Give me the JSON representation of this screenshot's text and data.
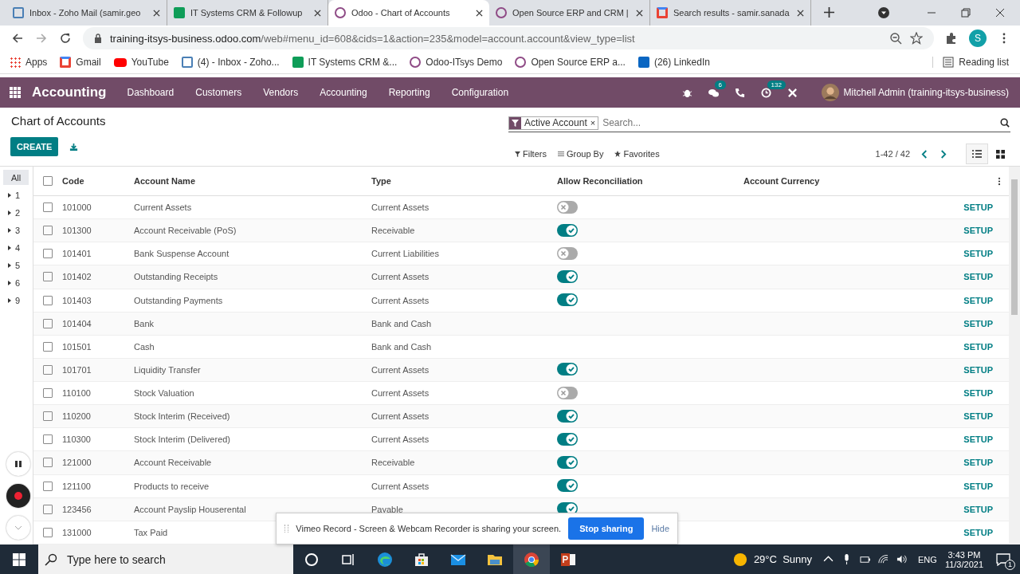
{
  "browser": {
    "tabs": [
      {
        "title": "Inbox - Zoho Mail (samir.geo",
        "kind": "mail",
        "selected": false
      },
      {
        "title": "IT Systems CRM & Followup",
        "kind": "sheet",
        "selected": false
      },
      {
        "title": "Odoo - Chart of Accounts",
        "kind": "odoo",
        "selected": true
      },
      {
        "title": "Open Source ERP and CRM |",
        "kind": "odoo",
        "selected": false
      },
      {
        "title": "Search results - samir.sanada",
        "kind": "gmail",
        "selected": false
      }
    ],
    "url_host": "training-itsys-business.odoo.com",
    "url_path": "/web#menu_id=608&cids=1&action=235&model=account.account&view_type=list",
    "profile_initial": "S",
    "bookmarks": [
      {
        "label": "Apps",
        "kind": "apps"
      },
      {
        "label": "Gmail",
        "kind": "gmail"
      },
      {
        "label": "YouTube",
        "kind": "youtube"
      },
      {
        "label": "(4) - Inbox - Zoho...",
        "kind": "mail"
      },
      {
        "label": "IT Systems CRM &...",
        "kind": "sheet"
      },
      {
        "label": "Odoo-ITsys Demo",
        "kind": "odoo"
      },
      {
        "label": "Open Source ERP a...",
        "kind": "odoo"
      },
      {
        "label": "(26) LinkedIn",
        "kind": "linkedin"
      }
    ],
    "reading_list": "Reading list"
  },
  "navbar": {
    "app": "Accounting",
    "menu": [
      "Dashboard",
      "Customers",
      "Vendors",
      "Accounting",
      "Reporting",
      "Configuration"
    ],
    "messages_count": "6",
    "activities_count": "132",
    "user": "Mitchell Admin (training-itsys-business)"
  },
  "control_panel": {
    "title": "Chart of Accounts",
    "create": "CREATE",
    "facet": "Active Account",
    "facet_remove": "×",
    "search_placeholder": "Search...",
    "filters": "Filters",
    "group_by": "Group By",
    "favorites": "Favorites",
    "pager": "1-42 / 42"
  },
  "groups": [
    {
      "label": "All",
      "selected": true
    },
    {
      "label": "1",
      "selected": false
    },
    {
      "label": "2",
      "selected": false
    },
    {
      "label": "3",
      "selected": false
    },
    {
      "label": "4",
      "selected": false
    },
    {
      "label": "5",
      "selected": false
    },
    {
      "label": "6",
      "selected": false
    },
    {
      "label": "9",
      "selected": false
    }
  ],
  "table": {
    "all_checked": false,
    "columns": [
      "Code",
      "Account Name",
      "Type",
      "Allow Reconciliation",
      "Account Currency"
    ],
    "rows": [
      {
        "checked": false,
        "code": "101000",
        "name": "Current Assets",
        "type": "Current Assets",
        "reconcile": false,
        "action": "SETUP"
      },
      {
        "checked": false,
        "code": "101300",
        "name": "Account Receivable (PoS)",
        "type": "Receivable",
        "reconcile": true,
        "action": "SETUP"
      },
      {
        "checked": false,
        "code": "101401",
        "name": "Bank Suspense Account",
        "type": "Current Liabilities",
        "reconcile": false,
        "action": "SETUP"
      },
      {
        "checked": false,
        "code": "101402",
        "name": "Outstanding Receipts",
        "type": "Current Assets",
        "reconcile": true,
        "action": "SETUP"
      },
      {
        "checked": false,
        "code": "101403",
        "name": "Outstanding Payments",
        "type": "Current Assets",
        "reconcile": true,
        "action": "SETUP"
      },
      {
        "checked": false,
        "code": "101404",
        "name": "Bank",
        "type": "Bank and Cash",
        "action": "SETUP"
      },
      {
        "checked": false,
        "code": "101501",
        "name": "Cash",
        "type": "Bank and Cash",
        "action": "SETUP"
      },
      {
        "checked": false,
        "code": "101701",
        "name": "Liquidity Transfer",
        "type": "Current Assets",
        "reconcile": true,
        "action": "SETUP"
      },
      {
        "checked": false,
        "code": "110100",
        "name": "Stock Valuation",
        "type": "Current Assets",
        "reconcile": false,
        "action": "SETUP"
      },
      {
        "checked": false,
        "code": "110200",
        "name": "Stock Interim (Received)",
        "type": "Current Assets",
        "reconcile": true,
        "action": "SETUP"
      },
      {
        "checked": false,
        "code": "110300",
        "name": "Stock Interim (Delivered)",
        "type": "Current Assets",
        "reconcile": true,
        "action": "SETUP"
      },
      {
        "checked": false,
        "code": "121000",
        "name": "Account Receivable",
        "type": "Receivable",
        "reconcile": true,
        "action": "SETUP"
      },
      {
        "checked": false,
        "code": "121100",
        "name": "Products to receive",
        "type": "Current Assets",
        "reconcile": true,
        "action": "SETUP"
      },
      {
        "checked": false,
        "code": "123456",
        "name": "Account Payslip Houserental",
        "type": "Payable",
        "reconcile": true,
        "action": "SETUP"
      },
      {
        "checked": false,
        "code": "131000",
        "name": "Tax Paid",
        "action": "SETUP"
      }
    ]
  },
  "share_bar": {
    "message": "Vimeo Record - Screen & Webcam Recorder is sharing your screen.",
    "stop": "Stop sharing",
    "hide": "Hide"
  },
  "taskbar": {
    "search_placeholder": "Type here to search",
    "weather": "29°C  Sunny",
    "language": "ENG",
    "time": "3:43 PM",
    "date": "11/3/2021",
    "notifications": "1"
  }
}
